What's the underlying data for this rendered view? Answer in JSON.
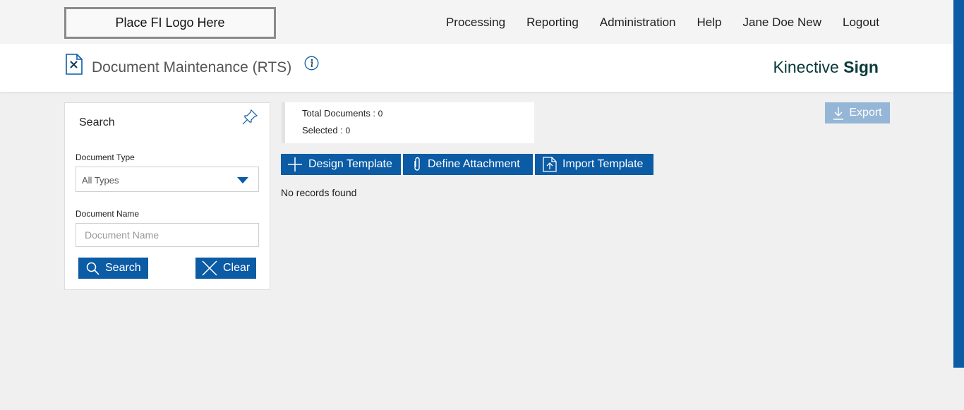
{
  "logo": {
    "text": "Place FI Logo Here"
  },
  "nav": {
    "processing": "Processing",
    "reporting": "Reporting",
    "administration": "Administration",
    "help": "Help",
    "user": "Jane Doe New",
    "logout": "Logout"
  },
  "header": {
    "title": "Document Maintenance (RTS)",
    "brand_light": "Kinective ",
    "brand_bold": "Sign"
  },
  "search": {
    "title": "Search",
    "doc_type_label": "Document Type",
    "doc_type_value": "All Types",
    "doc_name_label": "Document Name",
    "doc_name_placeholder": "Document Name",
    "doc_name_value": "",
    "search_label": "Search",
    "clear_label": "Clear"
  },
  "summary": {
    "total_label": "Total Documents : ",
    "total_value": "0",
    "selected_label": "Selected : ",
    "selected_value": "0"
  },
  "actions": {
    "design_template": "Design Template",
    "define_attachment": "Define Attachment",
    "import_template": "Import Template",
    "export": "Export"
  },
  "results": {
    "empty_message": "No records found"
  },
  "colors": {
    "primary": "#0b5ba5",
    "export_disabled": "#95b6d6",
    "brand_text": "#0b3a3a"
  }
}
